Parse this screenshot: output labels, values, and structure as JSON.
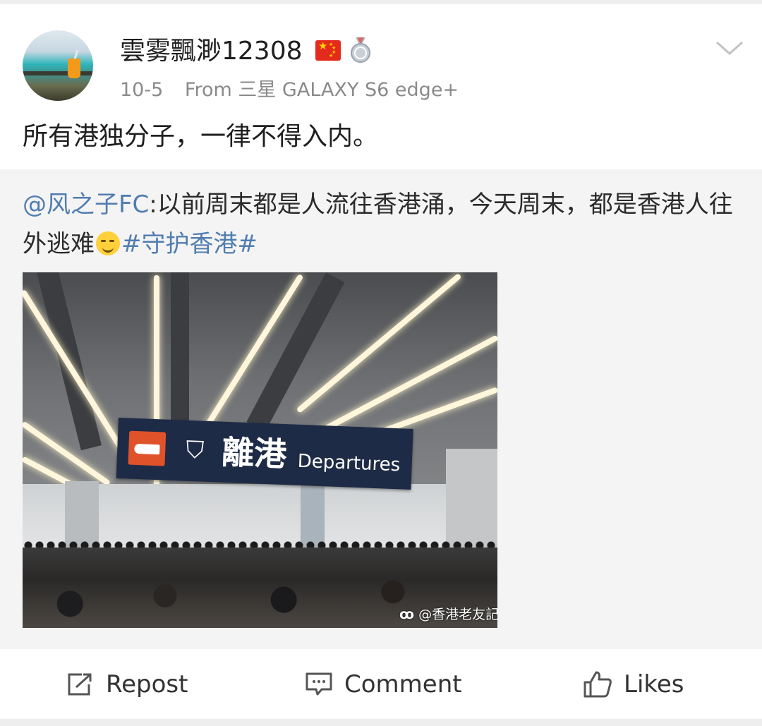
{
  "post": {
    "author": {
      "name": "雲雾飄渺12308",
      "flag_icon": "china-flag-icon",
      "badge_icon": "medal-badge-icon"
    },
    "date": "10-5",
    "source": "From 三星 GALAXY S6 edge+",
    "menu_icon": "chevron-down-icon",
    "text": "所有港独分子，一律不得入内。"
  },
  "retweet": {
    "mention": "@风之子FC",
    "text": ":以前周末都是人流往香港涌，今天周末，都是香港人往外逃难",
    "emoji": "grin-sweat-emoji",
    "hashtag": "#守护香港#",
    "image": {
      "description_icon": "departures-hall-photo",
      "sign_zh": "離港",
      "sign_en": "Departures",
      "watermark": "@香港老友記"
    }
  },
  "actions": {
    "repost_label": "Repost",
    "comment_label": "Comment",
    "likes_label": "Likes"
  },
  "colors": {
    "link": "#507daf",
    "text": "#1f1f1f",
    "meta": "#8a8a8a",
    "quoted_bg": "#f4f4f4"
  }
}
